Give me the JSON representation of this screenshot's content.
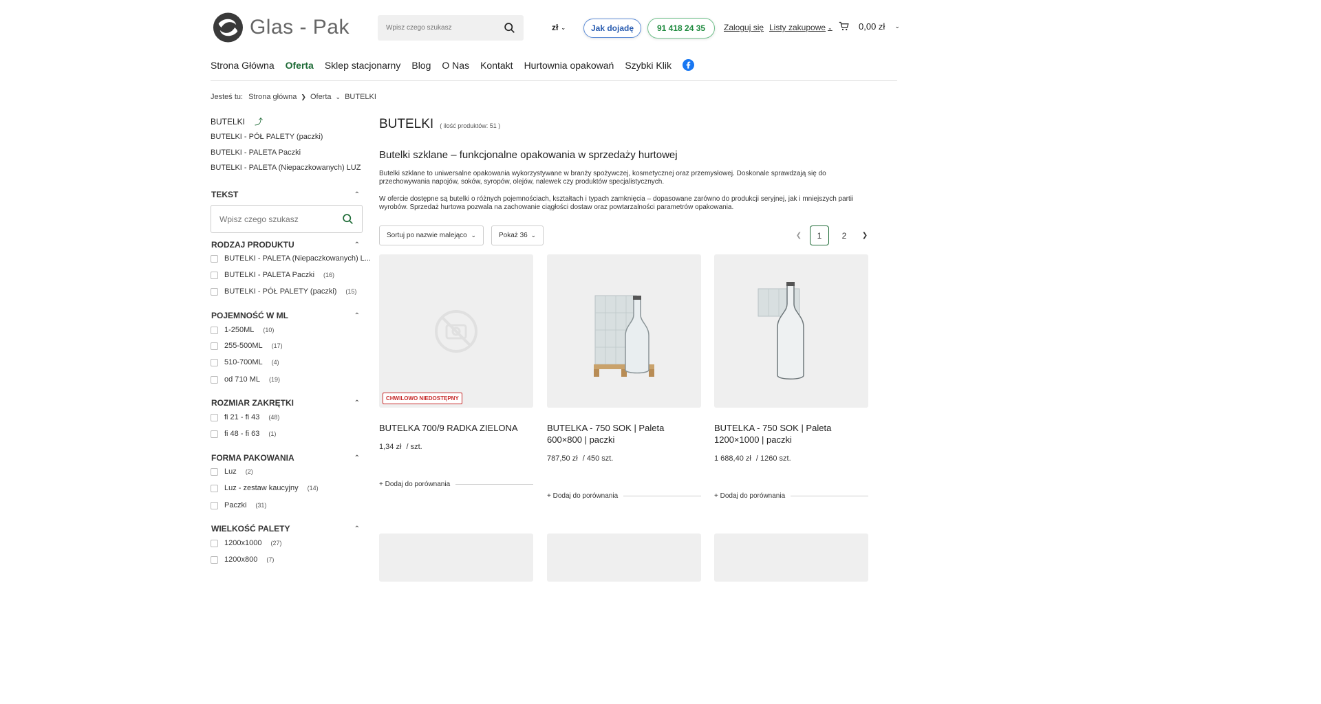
{
  "header": {
    "logo_text": "Glas - Pak",
    "search_placeholder": "Wpisz czego szukasz",
    "currency": "zł",
    "directions_label": "Jak dojadę",
    "phone": "91 418 24 35",
    "login_label": "Zaloguj się",
    "lists_label": "Listy zakupowe",
    "cart_total": "0,00 zł"
  },
  "nav": {
    "items": [
      {
        "label": "Strona Główna"
      },
      {
        "label": "Oferta"
      },
      {
        "label": "Sklep stacjonarny"
      },
      {
        "label": "Blog"
      },
      {
        "label": "O Nas"
      },
      {
        "label": "Kontakt"
      },
      {
        "label": "Hurtownia opakowań"
      },
      {
        "label": "Szybki Klik"
      }
    ]
  },
  "breadcrumb": {
    "prefix": "Jesteś tu:",
    "items": [
      "Strona główna",
      "Oferta",
      "BUTELKI"
    ]
  },
  "sidebar": {
    "category": "BUTELKI",
    "subcategories": [
      "BUTELKI - PÓŁ PALETY (paczki)",
      "BUTELKI - PALETA Paczki",
      "BUTELKI - PALETA (Niepaczkowanych) LUZ"
    ],
    "text_filter": {
      "title": "TEKST",
      "placeholder": "Wpisz czego szukasz"
    },
    "filters": [
      {
        "title": "RODZAJ PRODUKTU",
        "options": [
          {
            "label": "BUTELKI - PALETA (Niepaczkowanych) L...",
            "count": ""
          },
          {
            "label": "BUTELKI - PALETA Paczki",
            "count": "(16)"
          },
          {
            "label": "BUTELKI - PÓŁ PALETY (paczki)",
            "count": "(15)"
          }
        ]
      },
      {
        "title": "POJEMNOŚĆ W ML",
        "options": [
          {
            "label": "1-250ML",
            "count": "(10)"
          },
          {
            "label": "255-500ML",
            "count": "(17)"
          },
          {
            "label": "510-700ML",
            "count": "(4)"
          },
          {
            "label": "od 710 ML",
            "count": "(19)"
          }
        ]
      },
      {
        "title": "ROZMIAR ZAKRĘTKI",
        "options": [
          {
            "label": "fi 21 - fi 43",
            "count": "(48)"
          },
          {
            "label": "fi 48 - fi 63",
            "count": "(1)"
          }
        ]
      },
      {
        "title": "FORMA PAKOWANIA",
        "options": [
          {
            "label": "Luz",
            "count": "(2)"
          },
          {
            "label": "Luz - zestaw kaucyjny",
            "count": "(14)"
          },
          {
            "label": "Paczki",
            "count": "(31)"
          }
        ]
      },
      {
        "title": "WIELKOŚĆ PALETY",
        "options": [
          {
            "label": "1200x1000",
            "count": "(27)"
          },
          {
            "label": "1200x800",
            "count": "(7)"
          }
        ]
      }
    ]
  },
  "main": {
    "title": "BUTELKI",
    "product_count": "( ilość produktów: 51 )",
    "section_title": "Butelki szklane – funkcjonalne opakowania w sprzedaży hurtowej",
    "desc_1": "Butelki szklane to uniwersalne opakowania wykorzystywane w branży spożywczej, kosmetycznej oraz przemysłowej. Doskonale sprawdzają się do przechowywania napojów, soków, syropów, olejów, nalewek czy produktów specjalistycznych.",
    "desc_2": "W ofercie dostępne są butelki o różnych pojemnościach, kształtach i typach zamknięcia – dopasowane zarówno do produkcji seryjnej, jak i mniejszych partii wyrobów. Sprzedaż hurtowa pozwala na zachowanie ciągłości dostaw oraz powtarzalności parametrów opakowania.",
    "sort_label": "Sortuj po nazwie malejąco",
    "show_label": "Pokaż 36",
    "pages": [
      "1",
      "2"
    ],
    "products": [
      {
        "name": "BUTELKA 700/9 RADKA ZIELONA",
        "price": "1,34 zł",
        "unit": "/  szt.",
        "badge": "CHWILOWO NIEDOSTĘPNY",
        "compare": "+ Dodaj do porównania"
      },
      {
        "name": "BUTELKA - 750 SOK | Paleta 600×800 | paczki",
        "price": "787,50 zł",
        "unit": "/ 450 szt.",
        "badge": "",
        "compare": "+ Dodaj do porównania"
      },
      {
        "name": "BUTELKA - 750 SOK | Paleta 1200×1000 | paczki",
        "price": "1 688,40 zł",
        "unit": "/ 1260 szt.",
        "badge": "",
        "compare": "+ Dodaj do porównania"
      }
    ]
  },
  "colors": {
    "accent_green": "#1e6b36",
    "phone_green": "#1e8a3e",
    "link_blue": "#2a5db0",
    "badge_red": "#c62828"
  }
}
